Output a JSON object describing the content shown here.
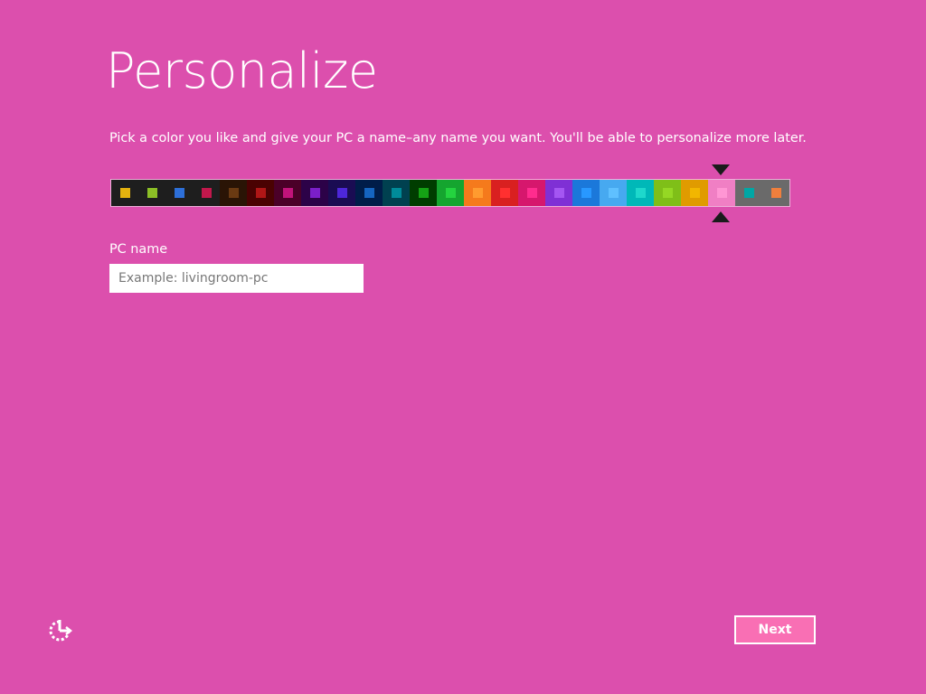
{
  "page": {
    "title": "Personalize",
    "subtitle": "Pick a color you like and give your PC a name–any name you want. You'll be able to personalize more later.",
    "background_color": "#dc4fad"
  },
  "palette": {
    "selected_index": 22,
    "swatches": [
      {
        "bg": "#1e1e1e",
        "dot": "#e3b10f"
      },
      {
        "bg": "#1e1e1e",
        "dot": "#8cbf26"
      },
      {
        "bg": "#1e1e1e",
        "dot": "#2d6fd8"
      },
      {
        "bg": "#1e1e1e",
        "dot": "#c2184c"
      },
      {
        "bg": "#2a1405",
        "dot": "#6a3a12"
      },
      {
        "bg": "#4a0202",
        "dot": "#b01616"
      },
      {
        "bg": "#4b0028",
        "dot": "#c1137a"
      },
      {
        "bg": "#2c0248",
        "dot": "#7b1fc9"
      },
      {
        "bg": "#1a0c53",
        "dot": "#4d27d9"
      },
      {
        "bg": "#001d49",
        "dot": "#1565c0"
      },
      {
        "bg": "#004150",
        "dot": "#008b99"
      },
      {
        "bg": "#003d00",
        "dot": "#15a315"
      },
      {
        "bg": "#15a52f",
        "dot": "#24d33f"
      },
      {
        "bg": "#f57a1c",
        "dot": "#ff9b2f"
      },
      {
        "bg": "#d92020",
        "dot": "#ff3030"
      },
      {
        "bg": "#d6176d",
        "dot": "#ff2c8e"
      },
      {
        "bg": "#7f30d5",
        "dot": "#a456f2"
      },
      {
        "bg": "#1b78da",
        "dot": "#2898ff"
      },
      {
        "bg": "#47a9f0",
        "dot": "#5fc0ff"
      },
      {
        "bg": "#00b8b8",
        "dot": "#1ed8cc"
      },
      {
        "bg": "#7fbf18",
        "dot": "#95d824"
      },
      {
        "bg": "#e09b00",
        "dot": "#f2b600"
      },
      {
        "bg": "#f07fc4",
        "dot": "#ff96d4"
      },
      {
        "bg": "#6a6a6a",
        "dot": "#00a7a5"
      },
      {
        "bg": "#6a6a6a",
        "dot": "#ef7f3d"
      }
    ]
  },
  "form": {
    "name_label": "PC name",
    "name_placeholder": "Example: livingroom-pc",
    "name_value": ""
  },
  "footer": {
    "ease_of_access_icon": "ease-of-access-icon",
    "next_label": "Next",
    "next_color": "#f96fb4"
  }
}
